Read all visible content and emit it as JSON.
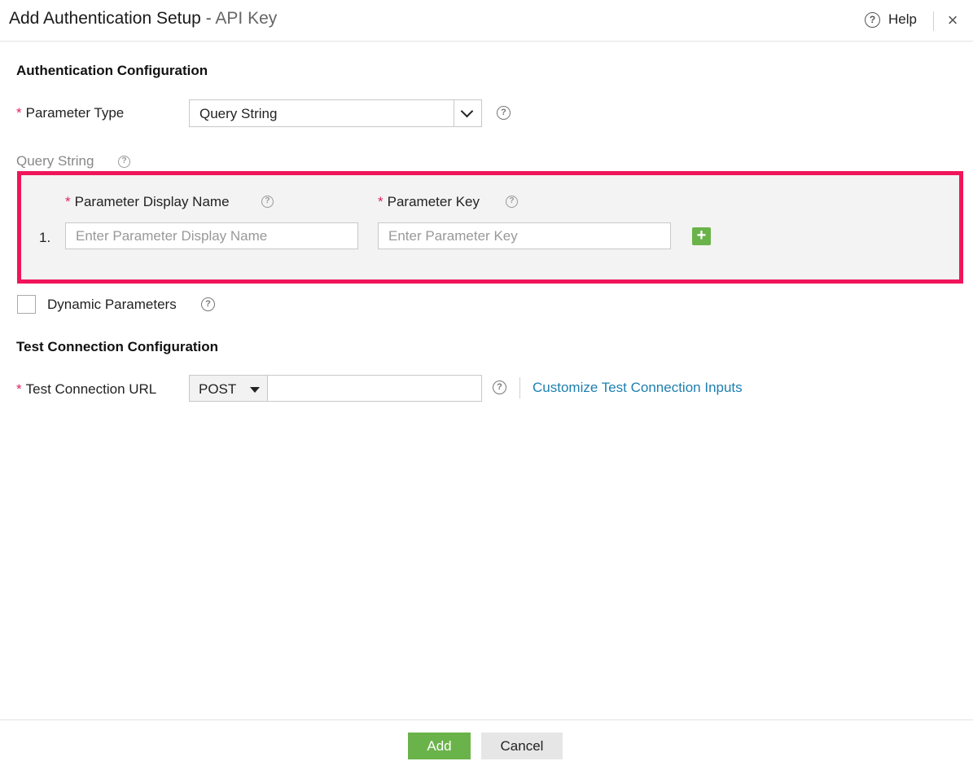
{
  "dialog": {
    "title": "Add Authentication Setup",
    "title_separator": "-",
    "subtitle": "API Key",
    "help_label": "Help",
    "help_icon": "?",
    "close_icon": "×"
  },
  "auth_config": {
    "heading": "Authentication Configuration",
    "required_mark": "*",
    "parameter_type_label": "Parameter Type",
    "parameter_type_value": "Query String",
    "query_string_label": "Query String",
    "params_table": {
      "display_name_header": "Parameter Display Name",
      "key_header": "Parameter Key",
      "rows": [
        {
          "index": "1.",
          "display_name_value": "",
          "display_name_placeholder": "Enter Parameter Display Name",
          "key_value": "",
          "key_placeholder": "Enter Parameter Key"
        }
      ],
      "add_row_icon": "+"
    },
    "dynamic_parameters_label": "Dynamic Parameters",
    "dynamic_parameters_checked": false
  },
  "test_config": {
    "heading": "Test Connection Configuration",
    "url_label": "Test Connection URL",
    "method_value": "POST",
    "url_value": "",
    "customize_link": "Customize Test Connection Inputs"
  },
  "footer": {
    "add_label": "Add",
    "cancel_label": "Cancel"
  },
  "colors": {
    "accent_green": "#6ab34a",
    "highlight_border": "#f0155a",
    "required_red": "#e0245e",
    "link_blue": "#1d7fb0"
  }
}
